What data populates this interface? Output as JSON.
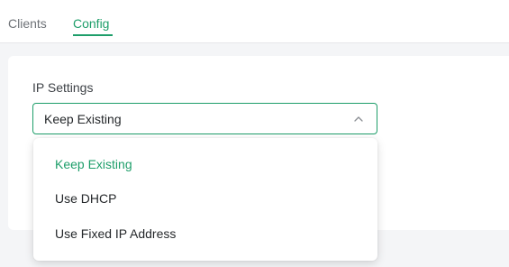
{
  "tabs": [
    {
      "label": "Clients",
      "active": false
    },
    {
      "label": "Config",
      "active": true
    }
  ],
  "ip_settings": {
    "label": "IP Settings",
    "selected_value": "Keep Existing",
    "options": [
      {
        "label": "Keep Existing",
        "selected": true
      },
      {
        "label": "Use DHCP",
        "selected": false
      },
      {
        "label": "Use Fixed IP Address",
        "selected": false
      }
    ]
  },
  "icons": {
    "select_toggle": "chevron-up-icon"
  },
  "colors": {
    "accent": "#1e9e6a",
    "page_background": "#f4f5f7",
    "card_background": "#ffffff",
    "text_primary": "#25282b",
    "text_muted": "#6f7378"
  }
}
